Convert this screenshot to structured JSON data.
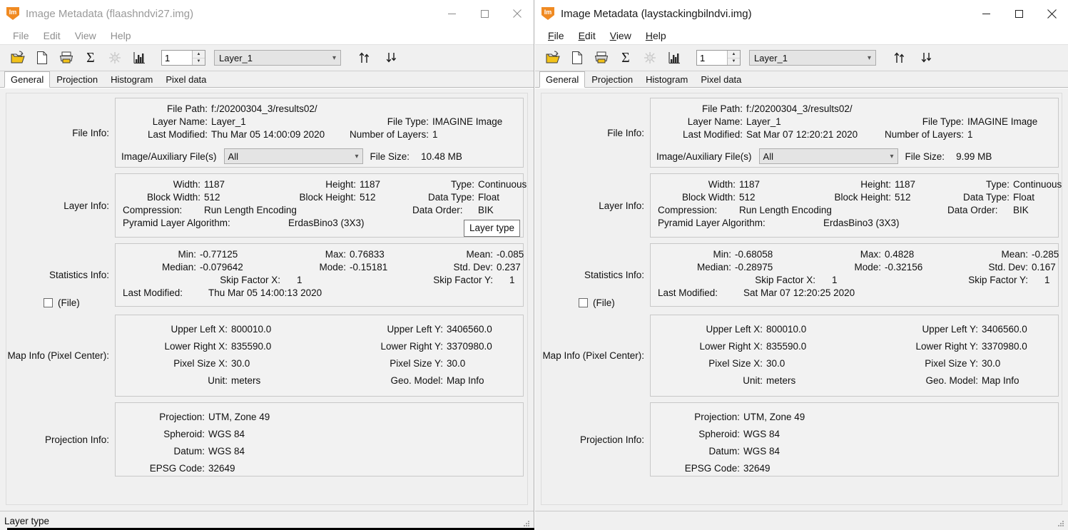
{
  "windows": [
    {
      "id": "left",
      "active": false,
      "title": "Image Metadata (flaashndvi27.img)",
      "app_icon": "imagine-shield-icon",
      "app_icon_glyph": "Im",
      "menu": [
        {
          "label": "File",
          "mnemonic": "F"
        },
        {
          "label": "Edit",
          "mnemonic": "E"
        },
        {
          "label": "View",
          "mnemonic": "V"
        },
        {
          "label": "Help",
          "mnemonic": "H"
        }
      ],
      "toolbar": {
        "buttons": [
          {
            "name": "open-file-icon",
            "tip": "Open"
          },
          {
            "name": "new-file-icon",
            "tip": "New"
          },
          {
            "name": "print-icon",
            "tip": "Print"
          },
          {
            "name": "statistics-sigma-icon",
            "tip": "Compute Statistics"
          },
          {
            "name": "pyramid-layers-icon",
            "tip": "Compute Pyramid Layers"
          },
          {
            "name": "histogram-icon",
            "tip": "Histogram"
          }
        ],
        "layer_number": "1",
        "layer_select": "Layer_1",
        "up_arrow_icon": "previous-layer-icon",
        "down_arrow_icon": "next-layer-icon"
      },
      "tabs": [
        {
          "label": "General",
          "active": true
        },
        {
          "label": "Projection",
          "active": false
        },
        {
          "label": "Histogram",
          "active": false
        },
        {
          "label": "Pixel data",
          "active": false
        }
      ],
      "sections": {
        "file_info": {
          "label": "File Info:",
          "file_path_label": "File Path:",
          "file_path": "f:/20200304_3/results02/",
          "layer_name_label": "Layer Name:",
          "layer_name": "Layer_1",
          "file_type_label": "File Type:",
          "file_type": "IMAGINE Image",
          "last_modified_label": "Last Modified:",
          "last_modified": "Thu Mar 05 14:00:09 2020",
          "number_of_layers_label": "Number of Layers:",
          "number_of_layers": "1",
          "aux_files_label": "Image/Auxiliary File(s)",
          "aux_files_value": "All",
          "file_size_label": "File Size:",
          "file_size": "10.48 MB"
        },
        "layer_info": {
          "label": "Layer Info:",
          "width_label": "Width:",
          "width": "1187",
          "height_label": "Height:",
          "height": "1187",
          "type_label": "Type:",
          "type": "Continuous",
          "block_width_label": "Block Width:",
          "block_width": "512",
          "block_height_label": "Block Height:",
          "block_height": "512",
          "data_type_label": "Data Type:",
          "data_type": "Float",
          "compression_label": "Compression:",
          "compression": "Run Length Encoding",
          "data_order_label": "Data Order:",
          "data_order": "BIK",
          "pyramid_label": "Pyramid Layer Algorithm:",
          "pyramid": "ErdasBino3 (3X3)"
        },
        "statistics_info": {
          "label": "Statistics Info:",
          "min_label": "Min:",
          "min": "-0.77125",
          "max_label": "Max:",
          "max": "0.76833",
          "mean_label": "Mean:",
          "mean": "-0.085",
          "median_label": "Median:",
          "median": "-0.079642",
          "mode_label": "Mode:",
          "mode": "-0.15181",
          "stddev_label": "Std. Dev:",
          "stddev": "0.237",
          "skipx_label": "Skip Factor X:",
          "skipx": "1",
          "skipy_label": "Skip Factor Y:",
          "skipy": "1",
          "last_modified_label": "Last Modified:",
          "last_modified": "Thu Mar 05 14:00:13 2020",
          "file_checkbox_label": "(File)",
          "file_checkbox_checked": false
        },
        "map_info": {
          "label": "Map Info (Pixel Center):",
          "ulx_label": "Upper Left X:",
          "ulx": "800010.0",
          "uly_label": "Upper Left Y:",
          "uly": "3406560.0",
          "lrx_label": "Lower Right X:",
          "lrx": "835590.0",
          "lry_label": "Lower Right Y:",
          "lry": "3370980.0",
          "psx_label": "Pixel Size X:",
          "psx": "30.0",
          "psy_label": "Pixel Size Y:",
          "psy": "30.0",
          "unit_label": "Unit:",
          "unit": "meters",
          "geo_label": "Geo. Model:",
          "geo": "Map Info"
        },
        "projection_info": {
          "label": "Projection Info:",
          "projection_label": "Projection:",
          "projection": "UTM, Zone 49",
          "spheroid_label": "Spheroid:",
          "spheroid": "WGS 84",
          "datum_label": "Datum:",
          "datum": "WGS 84",
          "epsg_label": "EPSG Code:",
          "epsg": "32649"
        }
      },
      "tooltip": "Layer type",
      "statusbar": "Layer type"
    },
    {
      "id": "right",
      "active": true,
      "title": "Image Metadata (laystackingbilndvi.img)",
      "app_icon": "imagine-shield-icon",
      "app_icon_glyph": "Im",
      "menu": [
        {
          "label": "File",
          "mnemonic": "F"
        },
        {
          "label": "Edit",
          "mnemonic": "E"
        },
        {
          "label": "View",
          "mnemonic": "V"
        },
        {
          "label": "Help",
          "mnemonic": "H"
        }
      ],
      "toolbar": {
        "buttons": [
          {
            "name": "open-file-icon",
            "tip": "Open"
          },
          {
            "name": "new-file-icon",
            "tip": "New"
          },
          {
            "name": "print-icon",
            "tip": "Print"
          },
          {
            "name": "statistics-sigma-icon",
            "tip": "Compute Statistics"
          },
          {
            "name": "pyramid-layers-icon",
            "tip": "Compute Pyramid Layers"
          },
          {
            "name": "histogram-icon",
            "tip": "Histogram"
          }
        ],
        "layer_number": "1",
        "layer_select": "Layer_1",
        "up_arrow_icon": "previous-layer-icon",
        "down_arrow_icon": "next-layer-icon"
      },
      "tabs": [
        {
          "label": "General",
          "active": true
        },
        {
          "label": "Projection",
          "active": false
        },
        {
          "label": "Histogram",
          "active": false
        },
        {
          "label": "Pixel data",
          "active": false
        }
      ],
      "sections": {
        "file_info": {
          "label": "File Info:",
          "file_path_label": "File Path:",
          "file_path": "f:/20200304_3/results02/",
          "layer_name_label": "Layer Name:",
          "layer_name": "Layer_1",
          "file_type_label": "File Type:",
          "file_type": "IMAGINE Image",
          "last_modified_label": "Last Modified:",
          "last_modified": "Sat Mar 07 12:20:21 2020",
          "number_of_layers_label": "Number of Layers:",
          "number_of_layers": "1",
          "aux_files_label": "Image/Auxiliary File(s)",
          "aux_files_value": "All",
          "file_size_label": "File Size:",
          "file_size": "9.99 MB"
        },
        "layer_info": {
          "label": "Layer Info:",
          "width_label": "Width:",
          "width": "1187",
          "height_label": "Height:",
          "height": "1187",
          "type_label": "Type:",
          "type": "Continuous",
          "block_width_label": "Block Width:",
          "block_width": "512",
          "block_height_label": "Block Height:",
          "block_height": "512",
          "data_type_label": "Data Type:",
          "data_type": "Float",
          "compression_label": "Compression:",
          "compression": "Run Length Encoding",
          "data_order_label": "Data Order:",
          "data_order": "BIK",
          "pyramid_label": "Pyramid Layer Algorithm:",
          "pyramid": "ErdasBino3 (3X3)"
        },
        "statistics_info": {
          "label": "Statistics Info:",
          "min_label": "Min:",
          "min": "-0.68058",
          "max_label": "Max:",
          "max": "0.4828",
          "mean_label": "Mean:",
          "mean": "-0.285",
          "median_label": "Median:",
          "median": "-0.28975",
          "mode_label": "Mode:",
          "mode": "-0.32156",
          "stddev_label": "Std. Dev:",
          "stddev": "0.167",
          "skipx_label": "Skip Factor X:",
          "skipx": "1",
          "skipy_label": "Skip Factor Y:",
          "skipy": "1",
          "last_modified_label": "Last Modified:",
          "last_modified": "Sat Mar 07 12:20:25 2020",
          "file_checkbox_label": "(File)",
          "file_checkbox_checked": false
        },
        "map_info": {
          "label": "Map Info (Pixel Center):",
          "ulx_label": "Upper Left X:",
          "ulx": "800010.0",
          "uly_label": "Upper Left Y:",
          "uly": "3406560.0",
          "lrx_label": "Lower Right X:",
          "lrx": "835590.0",
          "lry_label": "Lower Right Y:",
          "lry": "3370980.0",
          "psx_label": "Pixel Size X:",
          "psx": "30.0",
          "psy_label": "Pixel Size Y:",
          "psy": "30.0",
          "unit_label": "Unit:",
          "unit": "meters",
          "geo_label": "Geo. Model:",
          "geo": "Map Info"
        },
        "projection_info": {
          "label": "Projection Info:",
          "projection_label": "Projection:",
          "projection": "UTM, Zone 49",
          "spheroid_label": "Spheroid:",
          "spheroid": "WGS 84",
          "datum_label": "Datum:",
          "datum": "WGS 84",
          "epsg_label": "EPSG Code:",
          "epsg": "32649"
        }
      },
      "statusbar": ""
    }
  ],
  "window_controls": {
    "minimize": "minimize-icon",
    "maximize": "maximize-icon",
    "close": "close-icon"
  },
  "colors": {
    "brand_orange": "#f08a22",
    "window_bg": "#f0f0f0",
    "titlebar_bg": "#ffffff",
    "inactive_text": "#9a9a9a",
    "active_text": "#1a1a1a",
    "group_border": "#c8c8c8"
  }
}
